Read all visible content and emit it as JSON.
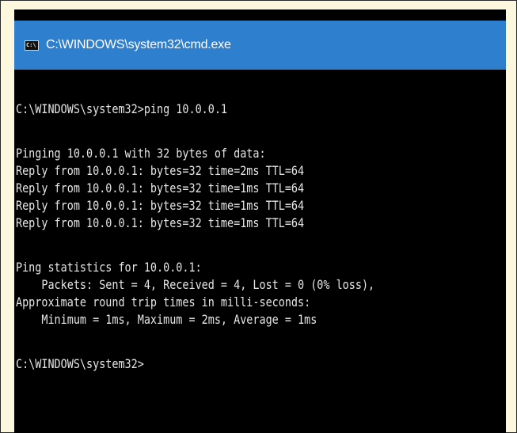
{
  "window": {
    "title": "C:\\WINDOWS\\system32\\cmd.exe",
    "icon": "cmd-icon",
    "icon_text": "C:\\"
  },
  "console": {
    "lines": [
      "C:\\WINDOWS\\system32>ping 10.0.0.1",
      "Pinging 10.0.0.1 with 32 bytes of data:",
      "Reply from 10.0.0.1: bytes=32 time=2ms TTL=64",
      "Reply from 10.0.0.1: bytes=32 time=1ms TTL=64",
      "Reply from 10.0.0.1: bytes=32 time=1ms TTL=64",
      "Reply from 10.0.0.1: bytes=32 time=1ms TTL=64",
      "Ping statistics for 10.0.0.1:",
      "    Packets: Sent = 4, Received = 4, Lost = 0 (0% loss),",
      "Approximate round trip times in milli-seconds:",
      "    Minimum = 1ms, Maximum = 2ms, Average = 1ms",
      "C:\\WINDOWS\\system32>"
    ]
  },
  "colors": {
    "titlebar": "#2f7fcf",
    "console_bg": "#000000",
    "console_text": "#e6e6e6",
    "page_bg": "#fdf8dd"
  }
}
